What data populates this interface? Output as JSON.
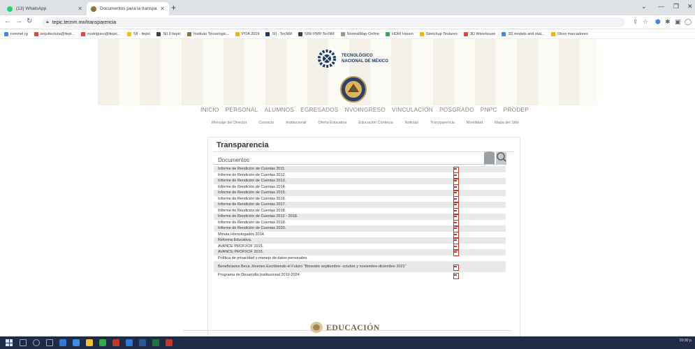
{
  "browser": {
    "tabs": [
      {
        "title": "(13) WhatsApp",
        "favicon_color": "#25d366",
        "active": false
      },
      {
        "title": "Documentos para la transparen",
        "favicon_color": "#8a7340",
        "active": true
      }
    ],
    "url": "tepic.tecnm.mx/transparencia",
    "bookmarks": [
      {
        "label": "rommel.rg",
        "color": "#4285f4"
      },
      {
        "label": "arquitectura@itepi...",
        "color": "#ea4335"
      },
      {
        "label": "rrodriguez@itepic...",
        "color": "#ea4335"
      },
      {
        "label": "SII - itepic",
        "color": "#fbbc05"
      },
      {
        "label": "SII 3 itepic",
        "color": "#3c4043"
      },
      {
        "label": "Instituto Tecnologic...",
        "color": "#8a7340"
      },
      {
        "label": "POA 2019",
        "color": "#f4b400"
      },
      {
        "label": "SII - TecNM",
        "color": "#1b396a"
      },
      {
        "label": "SIIE-PRR-TecNM",
        "color": "#3c4043"
      },
      {
        "label": "NormalMap-Online",
        "color": "#999999"
      },
      {
        "label": "HDRI Haven",
        "color": "#34a853"
      },
      {
        "label": "Sketchup Textures",
        "color": "#f4b400"
      },
      {
        "label": "3D Warehouse",
        "color": "#ea4335"
      },
      {
        "label": "3D models and mat...",
        "color": "#4285f4"
      },
      {
        "label": "Otros marcadores",
        "color": "#f4b400"
      }
    ]
  },
  "site": {
    "logo_line1": "TECNOLÓGICO",
    "logo_line2": "NACIONAL DE MÉXICO",
    "main_nav": [
      "INICIO",
      "PERSONAL",
      "ALUMNOS",
      "EGRESADOS",
      "NVOINGRESO",
      "VINCULACIÓN",
      "POSGRADO",
      "PNPC",
      "PRODEP"
    ],
    "sub_nav": [
      "Mensaje del Director",
      "Contacto",
      "Institucional",
      "Oferta Educativa",
      "Educación Continua",
      "Noticias",
      "Transparencia",
      "Movilidad",
      "Mapa del Sitio"
    ],
    "panel_title": "Transparencia",
    "docs_title": "Documentos",
    "documents": [
      {
        "label": "Informe de Rendición de Cuentas 2011.",
        "pdf": true
      },
      {
        "label": "Informe de Rendición de Cuentas 2012.",
        "pdf": true
      },
      {
        "label": "Informe de Rendición de Cuentas 2013.",
        "pdf": true
      },
      {
        "label": "Informe de Rendición de Cuentas 2014.",
        "pdf": true
      },
      {
        "label": "Informe de Rendición de Cuentas 2015.",
        "pdf": true
      },
      {
        "label": "Informe de Rendición de Cuentas 2016.",
        "pdf": true
      },
      {
        "label": "Informe de Rendición de Cuentas 2017.",
        "pdf": true
      },
      {
        "label": "Informe de Rendición de Cuentas 2018.",
        "pdf": true
      },
      {
        "label": "Informe de Rendición de Cuentas 2012 - 2018.",
        "pdf": true
      },
      {
        "label": "Informe de Rendición de Cuentas 2019.",
        "pdf": true
      },
      {
        "label": "Informe de Rendición de Cuentas 2020.",
        "pdf": true
      },
      {
        "label": "Minuta Homologados 2014.",
        "pdf": true
      },
      {
        "label": "Reforma Educativa.",
        "pdf": true
      },
      {
        "label": "AVANCE PROFXOF 2015.",
        "pdf": true
      },
      {
        "label": "AVANCE PROFXOF 2016.",
        "pdf": true
      },
      {
        "label": "Política de privacidad y manejo de datos personales.",
        "pdf": false
      },
      {
        "label": "Beneficiarios Beca Jóvenes Escribiendo el Futuro \"Bimestre septiembre- octubre y noviembre-diciembre 2021\"",
        "pdf": true,
        "tall": true
      },
      {
        "label": "Programa de Desarrollo Institucional 2019-2024",
        "pdf": true
      }
    ],
    "footer_brand": "EDUCACIÓN"
  },
  "taskbar": {
    "icons": [
      {
        "name": "search-icon",
        "color": "#9aa7bd"
      },
      {
        "name": "cortana-icon",
        "color": "#9aa7bd"
      },
      {
        "name": "task-view-icon",
        "color": "#9aa7bd"
      },
      {
        "name": "store-icon",
        "color": "#2d7dd2"
      },
      {
        "name": "mail-icon",
        "color": "#3a8ee6"
      },
      {
        "name": "explorer-icon",
        "color": "#f2c12e"
      },
      {
        "name": "chrome-icon",
        "color": "#34a853"
      },
      {
        "name": "autocad-icon",
        "color": "#c0392b"
      },
      {
        "name": "powerpoint-icon",
        "color": "#2b7bd6"
      },
      {
        "name": "word-icon",
        "color": "#2b5797"
      },
      {
        "name": "excel-icon",
        "color": "#1e7145"
      },
      {
        "name": "acrobat-icon",
        "color": "#c0392b"
      }
    ],
    "time": "03:30 p."
  }
}
